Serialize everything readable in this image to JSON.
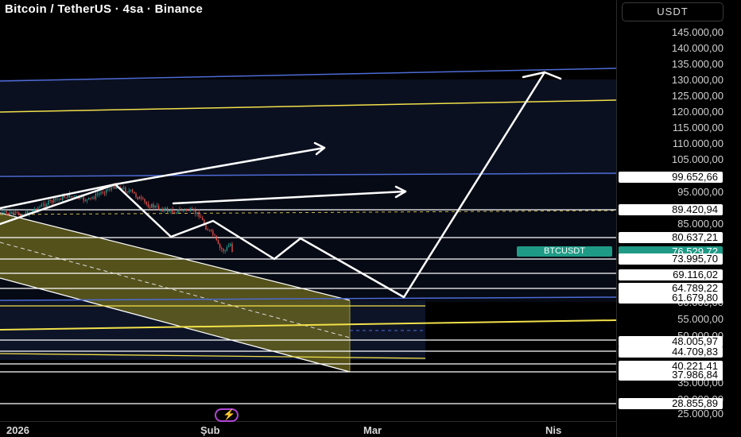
{
  "header": {
    "title": "Bitcoin / TetherUS · 4sa · Binance"
  },
  "price_axis": {
    "currency": "USDT",
    "ticks": [
      "145.000,00",
      "140.000,00",
      "135.000,00",
      "130.000,00",
      "125.000,00",
      "120.000,00",
      "115.000,00",
      "110.000,00",
      "105.000,00",
      "95.000,00",
      "85.000,00",
      "80.637,21",
      "60.000,00",
      "55.000,00",
      "50.000,00",
      "35.000,00",
      "30.000,00",
      "25.000,00"
    ],
    "level_labels": [
      "99.652,66",
      "89.420,94",
      "73.995,70",
      "69.116,02",
      "64.789,22",
      "61.679,80",
      "48.005,97",
      "44.709,83",
      "40.221,41",
      "37.986,84",
      "28.855,89"
    ],
    "current_price": "76.529,72",
    "symbol": "BTCUSDT"
  },
  "time_axis": {
    "labels": [
      "2026",
      "Şub",
      "Mar",
      "Nis"
    ]
  },
  "colors": {
    "background": "#000000",
    "blue_line": "#4d6bd6",
    "yellow_line": "#f2e14a",
    "white_line": "#ffffff",
    "yellow_channel": "#7a7020",
    "current_price_badge": "#1f9a86",
    "up_candle": "#26a69a",
    "down_candle": "#ef5350"
  },
  "icons": {
    "quick_action": "lightning-icon"
  }
}
